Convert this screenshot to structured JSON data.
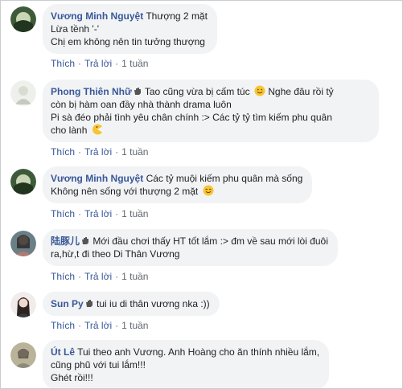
{
  "actions": {
    "like": "Thích",
    "reply": "Trả lời",
    "separator": "·"
  },
  "comments": [
    {
      "author": "Vương Minh Nguyệt",
      "lines": [
        "Thượng 2 mặt",
        "Lừa tềnh '-'",
        "Chị em không nên tin tưởng thượng"
      ],
      "time": "1 tuần"
    },
    {
      "author": "Phong Thiên Nhữ",
      "lines": [
        "Tao cũng vừa bị cấm túc",
        "Nghe đâu rồi tỷ",
        "còn bị hàm oan đầy nhà thành drama luôn",
        "Pi sà đéo phải tình yêu chân chính :> Các tỷ tỷ tìm kiếm phu quân",
        "cho lành"
      ],
      "time": "1 tuần"
    },
    {
      "author": "Vương Minh Nguyệt",
      "lines": [
        "Các tỷ muội kiếm phu quân mà sống",
        "Không nên sống với thượng 2 mặt"
      ],
      "time": "1 tuần"
    },
    {
      "author": "陆豚儿",
      "lines": [
        "Mới đầu chơi thấy HT tốt lắm :> đm về sau mới lòi đuôi",
        "ra,hừ,t đi theo Di Thân Vương"
      ],
      "time": "1 tuần"
    },
    {
      "author": "Sun Py",
      "lines": [
        "tui iu di thân vương nka :))"
      ],
      "time": "1 tuần"
    },
    {
      "author": "Út Lê",
      "lines": [
        "Tui theo anh Vương. Anh Hoàng cho ăn thính nhiều lắm,",
        "cũng phũ với tui lắm!!!",
        "Ghét rồi!!!"
      ],
      "time": ""
    }
  ],
  "colors": {
    "author": "#385898",
    "bubble": "#f2f3f5",
    "meta": "#606770"
  }
}
